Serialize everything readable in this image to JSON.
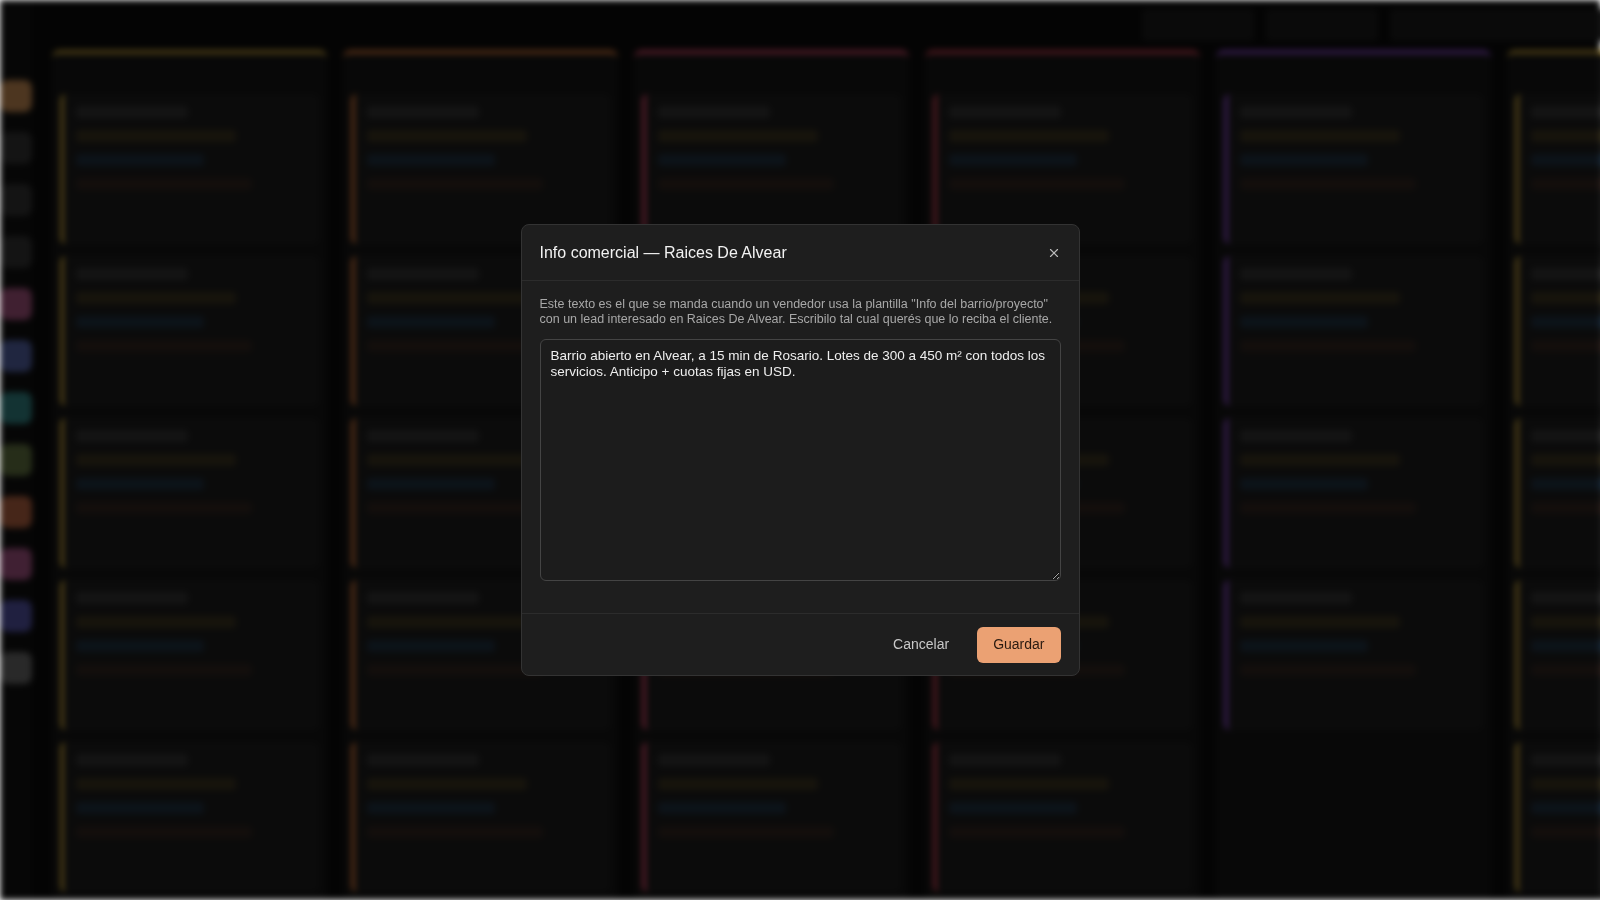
{
  "dialog": {
    "title": "Info comercial — Raices De Alvear",
    "description": "Este texto es el que se manda cuando un vendedor usa la plantilla \"Info del barrio/proyecto\" con un lead interesado en Raices De Alvear. Escribilo tal cual querés que lo reciba el cliente.",
    "message": {
      "value": "Barrio abierto en Alvear, a 15 min de Rosario. Lotes de 300 a 450 m² con todos los servicios. Anticipo + cuotas fijas en USD."
    },
    "buttons": [
      {
        "label": "Cancelar",
        "kind": "secondary"
      },
      {
        "label": "Guardar",
        "kind": "primary"
      }
    ]
  }
}
